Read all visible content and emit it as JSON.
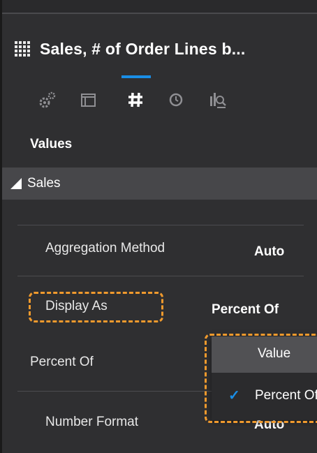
{
  "header": {
    "title": "Sales, # of Order Lines b...",
    "icon": "grid-table-icon"
  },
  "tabs": [
    {
      "name": "general-settings",
      "icon": "gears-icon"
    },
    {
      "name": "layout",
      "icon": "window-icon"
    },
    {
      "name": "values",
      "icon": "hash-icon",
      "active": true
    },
    {
      "name": "time",
      "icon": "clock-icon"
    },
    {
      "name": "analytics",
      "icon": "chart-search-icon"
    }
  ],
  "values_label": "Values",
  "section": {
    "label": "Sales"
  },
  "properties": {
    "aggregation": {
      "label": "Aggregation Method",
      "value": "Auto"
    },
    "display_as": {
      "label": "Display As",
      "value": "Percent Of"
    },
    "percent_of": {
      "label": "Percent Of"
    },
    "number_format": {
      "label": "Number Format",
      "value": "Auto"
    }
  },
  "dropdown": {
    "options": [
      "Value",
      "Percent Of"
    ],
    "selected": "Percent Of"
  },
  "colors": {
    "accent": "#1a8ee6",
    "highlight": "#f09a2d",
    "background": "#2f2f31",
    "section_bar": "#47474a"
  }
}
